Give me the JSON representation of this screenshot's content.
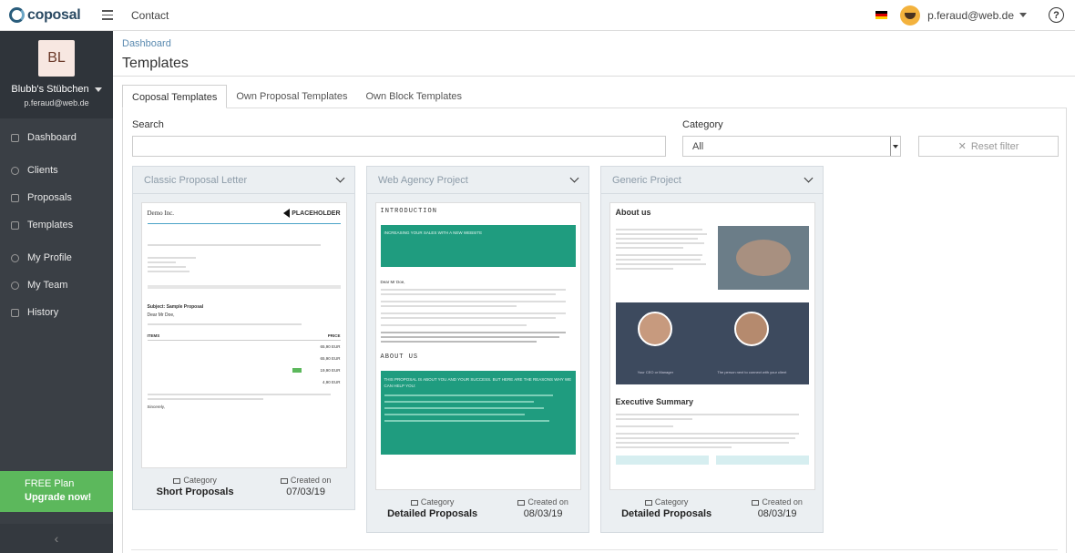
{
  "topbar": {
    "logo": "coposal",
    "contact": "Contact",
    "flag_colors": [
      "#000000",
      "#dd0000",
      "#ffce00"
    ],
    "user_email": "p.feraud@web.de",
    "help": "?"
  },
  "sidebar": {
    "avatar_initials": "BL",
    "company": "Blubb's Stübchen",
    "email": "p.feraud@web.de",
    "items": [
      {
        "label": "Dashboard",
        "icon": "dashboard-icon"
      },
      {
        "label": "Clients",
        "icon": "clients-icon"
      },
      {
        "label": "Proposals",
        "icon": "proposals-icon"
      },
      {
        "label": "Templates",
        "icon": "templates-icon"
      },
      {
        "label": "My Profile",
        "icon": "profile-icon"
      },
      {
        "label": "My Team",
        "icon": "team-icon"
      },
      {
        "label": "History",
        "icon": "history-icon"
      }
    ],
    "plan": "FREE Plan",
    "upgrade": "Upgrade now!",
    "collapse_icon": "chevron-left-icon"
  },
  "main": {
    "breadcrumb": "Dashboard",
    "title": "Templates",
    "tabs": [
      {
        "label": "Coposal Templates",
        "active": true
      },
      {
        "label": "Own Proposal Templates",
        "active": false
      },
      {
        "label": "Own Block Templates",
        "active": false
      }
    ],
    "search_label": "Search",
    "search_value": "",
    "category_label": "Category",
    "category_value": "All",
    "reset_filter": "Reset filter"
  },
  "cards": [
    {
      "title": "Classic Proposal Letter",
      "category_label": "Category",
      "category": "Short Proposals",
      "created_label": "Created on",
      "created": "07/03/19",
      "preview": {
        "company": "Demo Inc.",
        "logo_text": "PLACEHOLDER",
        "subject": "Subject: Sample Proposal",
        "greeting": "Dear Mr Doe,",
        "items_head": "ITEMS",
        "price_head": "PRICE",
        "prices": [
          "65,90 EUR",
          "65,90 EUR",
          "19,90 EUR",
          "4,90 EUR"
        ],
        "sign": "Sincerely,"
      }
    },
    {
      "title": "Web Agency Project",
      "category_label": "Category",
      "category": "Detailed Proposals",
      "created_label": "Created on",
      "created": "08/03/19",
      "preview": {
        "intro": "INTRODUCTION",
        "banner": "INCREASING YOUR SALES WITH A NEW WEBSITE",
        "greeting": "Dear Mr Doe,",
        "about": "ABOUT US",
        "about_banner": "THIS PROPOSAL IS ABOUT YOU AND YOUR SUCCESS. BUT HERE ARE THE REASONS WHY WE CAN HELP YOU:"
      }
    },
    {
      "title": "Generic Project",
      "category_label": "Category",
      "category": "Detailed Proposals",
      "created_label": "Created on",
      "created": "08/03/19",
      "preview": {
        "about": "About us",
        "ceo": "Your CEO or Manager",
        "contact_person": "The person next to connect with your client",
        "summary": "Executive Summary"
      }
    }
  ]
}
